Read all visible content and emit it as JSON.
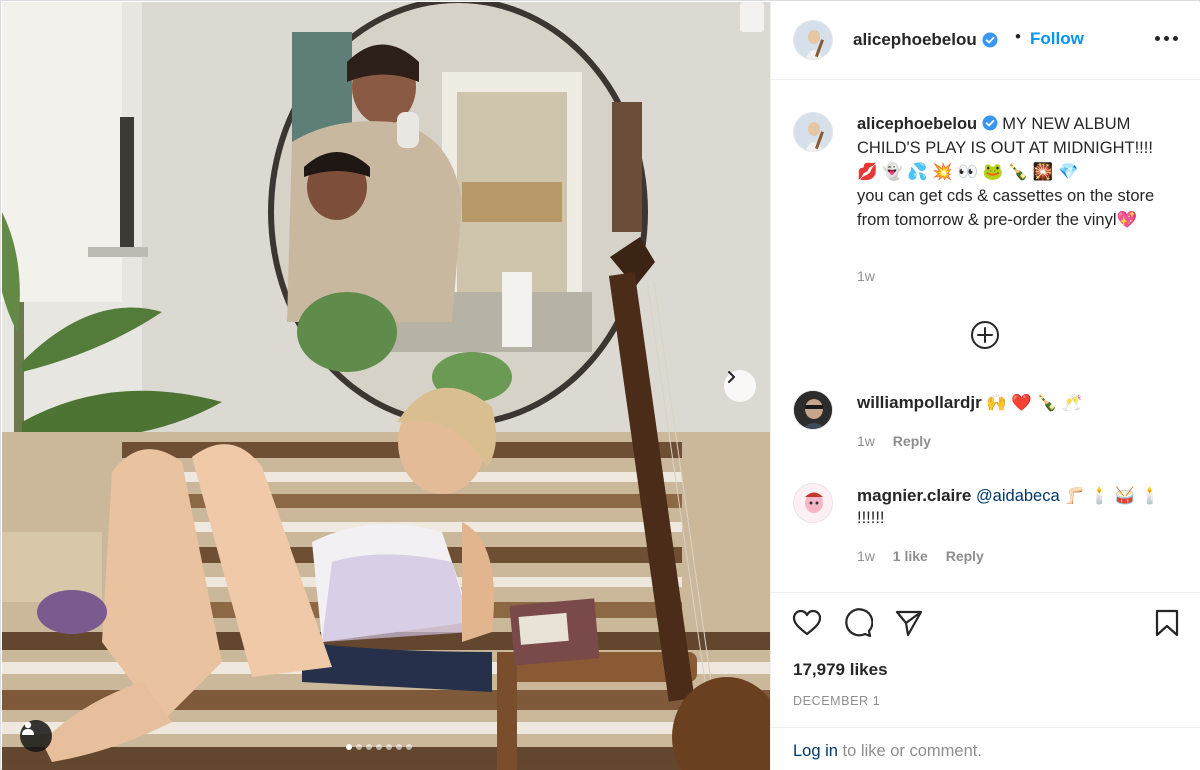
{
  "post": {
    "username": "alicephoebelou",
    "follow_label": "Follow",
    "separator": "•",
    "caption_line1": "MY NEW ALBUM CHILD'S PLAY IS OUT AT MIDNIGHT!!!!",
    "caption_emojis": "💋 👻 💦 💥 👀 🐸 🍾 🎇 💎",
    "caption_line2": "you can get cds & cassettes on the store from tomorrow & pre-order the vinyl💖",
    "caption_time": "1w",
    "slides_total": 7,
    "slide_active": 1
  },
  "comments": [
    {
      "username": "williampollardjr",
      "text": "🙌 ❤️ 🍾 🥂",
      "time": "1w",
      "reply_label": "Reply"
    },
    {
      "username": "magnier.claire",
      "mention": "@aidabeca",
      "text": "🦵🏻 🕯️ 🥁 🕯️ !!!!!!",
      "time": "1w",
      "likes_label": "1 like",
      "reply_label": "Reply"
    }
  ],
  "footer": {
    "likes": "17,979 likes",
    "date": "DECEMBER 1",
    "login_link": "Log in",
    "login_rest": " to like or comment."
  },
  "icons": {
    "next": "chevron-right-icon",
    "tag": "user-tag-icon",
    "more": "more-options-icon",
    "load_more": "plus-circle-icon",
    "like": "heart-icon",
    "comment": "comment-icon",
    "share": "paper-plane-icon",
    "save": "bookmark-icon",
    "verified": "verified-badge-icon"
  },
  "colors": {
    "link_blue": "#0095f6",
    "dark_link": "#00376b",
    "muted": "#8e8e8e",
    "verified": "#3897f0"
  }
}
